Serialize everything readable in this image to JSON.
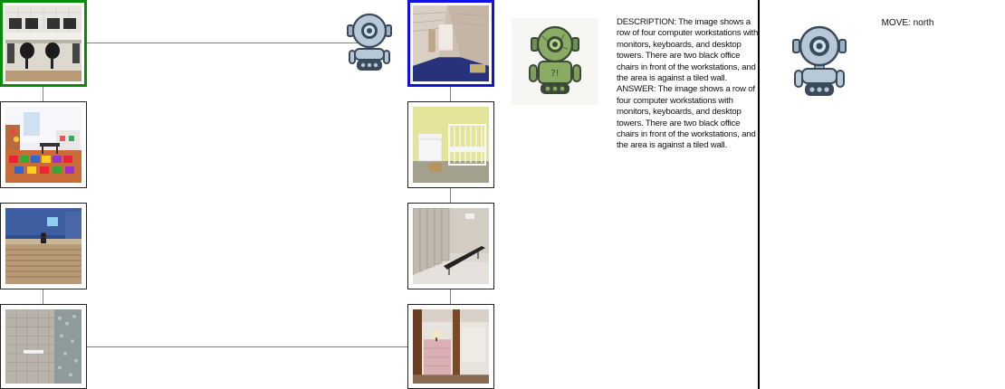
{
  "description_text": "DESCRIPTION: The image shows a row of four computer workstations with monitors, keyboards, and desktop towers. There are two black office chairs in front of the workstations, and the area is against a tiled wall.  ANSWER: The image shows a row of four computer workstations with monitors, keyboards, and desktop towers. There are two black office chairs in front of the workstations, and the area is against a tiled wall.",
  "move_text": "MOVE: north",
  "map": {
    "start_color": "#0a8a0a",
    "current_color": "#1010e0",
    "tiles": [
      {
        "scene": "computer workstations",
        "state": "start"
      },
      {
        "scene": "attic room",
        "state": "current"
      },
      {
        "scene": "playroom",
        "state": "plain"
      },
      {
        "scene": "nursery with crib",
        "state": "plain"
      },
      {
        "scene": "lobby reception desk",
        "state": "plain"
      },
      {
        "scene": "locker room",
        "state": "plain"
      },
      {
        "scene": "shower stall",
        "state": "plain"
      },
      {
        "scene": "basement",
        "state": "plain"
      }
    ]
  },
  "icons": {
    "map_robot": "robot-icon",
    "agent_robot": "robot-icon",
    "move_robot": "robot-icon"
  },
  "colors": {
    "robot_blue": "#b7c9d8",
    "robot_green": "#7fa05a",
    "outline": "#3a4a5a"
  }
}
